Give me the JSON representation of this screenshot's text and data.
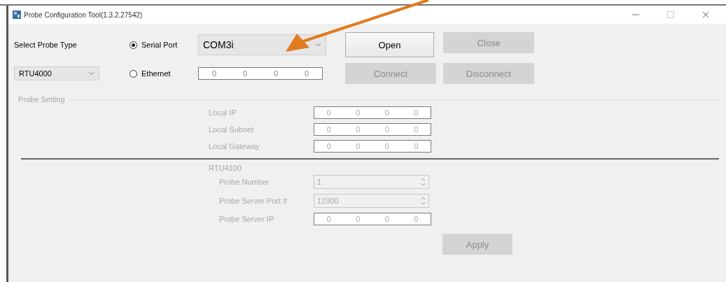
{
  "window": {
    "title": "Probe Configuration Tool(1.3.2.27542)"
  },
  "probe_type": {
    "label": "Select Probe Type",
    "value": "RTU4000"
  },
  "connection": [
    {
      "kind": "combo",
      "label": "Serial Port",
      "selected": true,
      "value": "COM3i"
    },
    {
      "kind": "ip",
      "label": "Ethernet",
      "selected": false,
      "octets": [
        "0",
        "0",
        "0",
        "0"
      ]
    }
  ],
  "buttons": [
    {
      "label": "Open",
      "disabled": false
    },
    {
      "label": "Close",
      "disabled": true
    },
    {
      "label": "Connect",
      "disabled": true
    },
    {
      "label": "Disconnect",
      "disabled": true
    }
  ],
  "probe_setting": {
    "title": "Probe Setting",
    "disabled": true,
    "network": [
      {
        "label": "Local IP",
        "octets": [
          "0",
          "0",
          "0",
          "0"
        ]
      },
      {
        "label": "Local Subnet",
        "octets": [
          "0",
          "0",
          "0",
          "0"
        ]
      },
      {
        "label": "Local Gateway",
        "octets": [
          "0",
          "0",
          "0",
          "0"
        ]
      }
    ],
    "section": "RTU4100",
    "probe": [
      {
        "kind": "spin",
        "label": "Probe Number",
        "value": "1"
      },
      {
        "kind": "spin",
        "label": "Probe Server Port #",
        "value": "12300"
      },
      {
        "kind": "ip",
        "label": "Probe Server IP",
        "octets": [
          "0",
          "0",
          "0",
          "0"
        ]
      }
    ],
    "apply": {
      "label": "Apply",
      "disabled": true
    }
  }
}
